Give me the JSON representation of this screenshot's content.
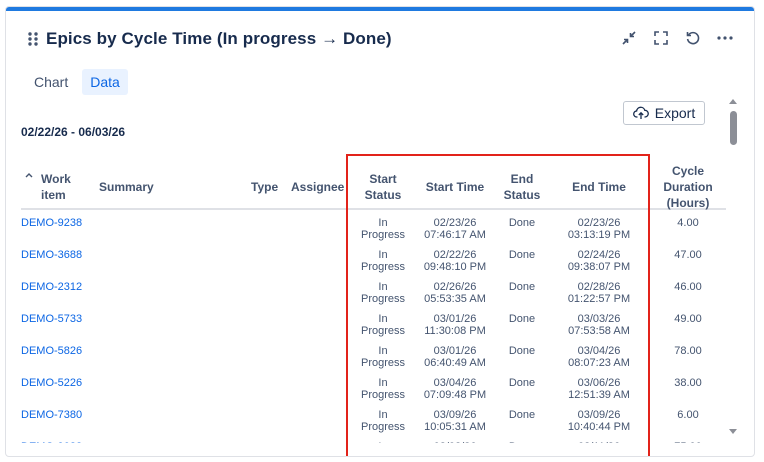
{
  "widget": {
    "title": "Epics by Cycle Time (In progress → Done)"
  },
  "tabs": [
    {
      "label": "Chart",
      "active": false
    },
    {
      "label": "Data",
      "active": true
    }
  ],
  "export_label": "Export",
  "date_range": "02/22/26 - 06/03/26",
  "columns": {
    "work_item": [
      "Work",
      "item"
    ],
    "summary": "Summary",
    "type": "Type",
    "assignee": "Assignee",
    "start_status": [
      "Start",
      "Status"
    ],
    "start_time": "Start Time",
    "end_status": [
      "End",
      "Status"
    ],
    "end_time": "End Time",
    "cycle_duration": [
      "Cycle",
      "Duration",
      "(Hours)"
    ]
  },
  "rows": [
    {
      "id": "DEMO-9238",
      "start_status": [
        "In",
        "Progress"
      ],
      "start_date": "02/23/26",
      "start_clock": "07:46:17 AM",
      "end_status": "Done",
      "end_date": "02/23/26",
      "end_clock": "03:13:19 PM",
      "duration": "4.00"
    },
    {
      "id": "DEMO-3688",
      "start_status": [
        "In",
        "Progress"
      ],
      "start_date": "02/22/26",
      "start_clock": "09:48:10 PM",
      "end_status": "Done",
      "end_date": "02/24/26",
      "end_clock": "09:38:07 PM",
      "duration": "47.00"
    },
    {
      "id": "DEMO-2312",
      "start_status": [
        "In",
        "Progress"
      ],
      "start_date": "02/26/26",
      "start_clock": "05:53:35 AM",
      "end_status": "Done",
      "end_date": "02/28/26",
      "end_clock": "01:22:57 PM",
      "duration": "46.00"
    },
    {
      "id": "DEMO-5733",
      "start_status": [
        "In",
        "Progress"
      ],
      "start_date": "03/01/26",
      "start_clock": "11:30:08 PM",
      "end_status": "Done",
      "end_date": "03/03/26",
      "end_clock": "07:53:58 AM",
      "duration": "49.00"
    },
    {
      "id": "DEMO-5826",
      "start_status": [
        "In",
        "Progress"
      ],
      "start_date": "03/01/26",
      "start_clock": "06:40:49 AM",
      "end_status": "Done",
      "end_date": "03/04/26",
      "end_clock": "08:07:23 AM",
      "duration": "78.00"
    },
    {
      "id": "DEMO-5226",
      "start_status": [
        "In",
        "Progress"
      ],
      "start_date": "03/04/26",
      "start_clock": "07:09:48 PM",
      "end_status": "Done",
      "end_date": "03/06/26",
      "end_clock": "12:51:39 AM",
      "duration": "38.00"
    },
    {
      "id": "DEMO-7380",
      "start_status": [
        "In",
        "Progress"
      ],
      "start_date": "03/09/26",
      "start_clock": "10:05:31 AM",
      "end_status": "Done",
      "end_date": "03/09/26",
      "end_clock": "10:40:44 PM",
      "duration": "6.00"
    },
    {
      "id": "DEMO-9033",
      "start_status": [
        "In",
        "Progress"
      ],
      "start_date": "03/08/26",
      "start_clock": "",
      "end_status": "Done",
      "end_date": "03/11/26",
      "end_clock": "",
      "duration": "75.00"
    }
  ],
  "colors": {
    "accent": "#1f7ae0",
    "link": "#0c66e4",
    "highlight": "#e2231a"
  },
  "icons": {
    "drag": "drag-handle-icon",
    "minimize": "minimize-icon",
    "fullscreen": "fullscreen-icon",
    "refresh": "refresh-icon",
    "more": "more-icon",
    "export": "cloud-upload-icon",
    "sort": "sort-up-icon"
  }
}
